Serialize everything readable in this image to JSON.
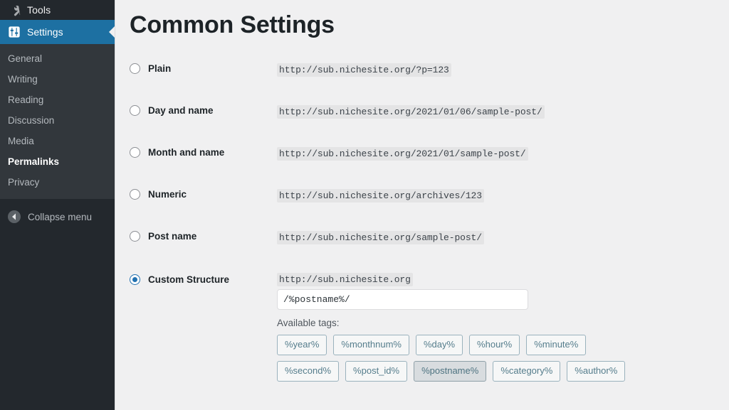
{
  "sidebar": {
    "top_items": [
      {
        "label": "Tools",
        "icon": "wrench-icon",
        "state": "normal"
      }
    ],
    "current_item": {
      "label": "Settings",
      "icon": "sliders-icon",
      "active": true
    },
    "submenu": [
      {
        "label": "General",
        "active": false
      },
      {
        "label": "Writing",
        "active": false
      },
      {
        "label": "Reading",
        "active": false
      },
      {
        "label": "Discussion",
        "active": false
      },
      {
        "label": "Media",
        "active": false
      },
      {
        "label": "Permalinks",
        "active": true
      },
      {
        "label": "Privacy",
        "active": false
      }
    ],
    "collapse": {
      "label": "Collapse menu",
      "icon": "arrow-left-circle-icon"
    },
    "colors": {
      "background": "#23282d",
      "submenu_background": "#32373c",
      "active_background": "#1d70a2",
      "text": "#b4b9be",
      "active_text": "#ffffff"
    }
  },
  "main": {
    "page_title": "Common Settings",
    "accent_color": "#2271b1",
    "options": [
      {
        "name": "Plain",
        "selected": false,
        "example": "http://sub.nichesite.org/?p=123"
      },
      {
        "name": "Day and name",
        "selected": false,
        "example": "http://sub.nichesite.org/2021/01/06/sample-post/"
      },
      {
        "name": "Month and name",
        "selected": false,
        "example": "http://sub.nichesite.org/2021/01/sample-post/"
      },
      {
        "name": "Numeric",
        "selected": false,
        "example": "http://sub.nichesite.org/archives/123"
      },
      {
        "name": "Post name",
        "selected": false,
        "example": "http://sub.nichesite.org/sample-post/"
      }
    ],
    "custom_structure": {
      "name": "Custom Structure",
      "selected": true,
      "site_prefix": "http://sub.nichesite.org",
      "value": "/%postname%/",
      "placeholder": "",
      "available_tags_label": "Available tags:",
      "tags": [
        {
          "label": "%year%",
          "used": false
        },
        {
          "label": "%monthnum%",
          "used": false
        },
        {
          "label": "%day%",
          "used": false
        },
        {
          "label": "%hour%",
          "used": false
        },
        {
          "label": "%minute%",
          "used": false
        },
        {
          "label": "%second%",
          "used": false
        },
        {
          "label": "%post_id%",
          "used": false
        },
        {
          "label": "%postname%",
          "used": true
        },
        {
          "label": "%category%",
          "used": false
        },
        {
          "label": "%author%",
          "used": false
        }
      ]
    }
  }
}
